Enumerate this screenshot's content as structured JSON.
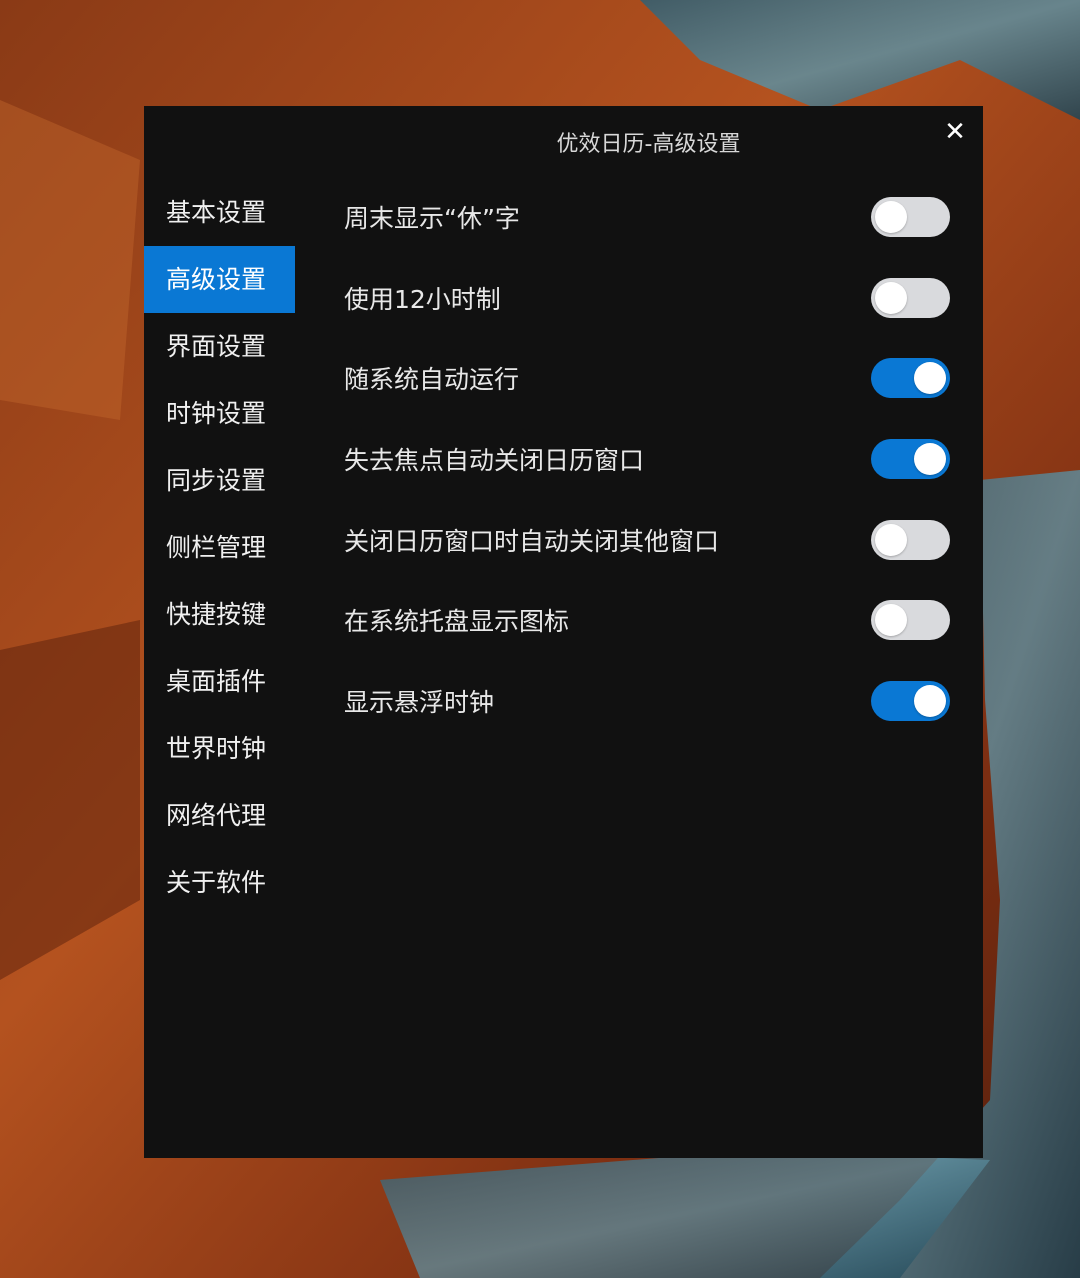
{
  "window": {
    "title": "优效日历-高级设置",
    "close_label": "✕"
  },
  "sidebar": {
    "items": [
      {
        "label": "基本设置",
        "active": false
      },
      {
        "label": "高级设置",
        "active": true
      },
      {
        "label": "界面设置",
        "active": false
      },
      {
        "label": "时钟设置",
        "active": false
      },
      {
        "label": "同步设置",
        "active": false
      },
      {
        "label": "侧栏管理",
        "active": false
      },
      {
        "label": "快捷按键",
        "active": false
      },
      {
        "label": "桌面插件",
        "active": false
      },
      {
        "label": "世界时钟",
        "active": false
      },
      {
        "label": "网络代理",
        "active": false
      },
      {
        "label": "关于软件",
        "active": false
      }
    ]
  },
  "settings": {
    "items": [
      {
        "label": "周末显示“休”字",
        "enabled": false
      },
      {
        "label": "使用12小时制",
        "enabled": false
      },
      {
        "label": "随系统自动运行",
        "enabled": true
      },
      {
        "label": "失去焦点自动关闭日历窗口",
        "enabled": true
      },
      {
        "label": "关闭日历窗口时自动关闭其他窗口",
        "enabled": false
      },
      {
        "label": "在系统托盘显示图标",
        "enabled": false
      },
      {
        "label": "显示悬浮时钟",
        "enabled": true
      }
    ]
  },
  "colors": {
    "accent": "#0a78d4",
    "window_bg": "#111111",
    "toggle_off": "#d9dadd"
  }
}
